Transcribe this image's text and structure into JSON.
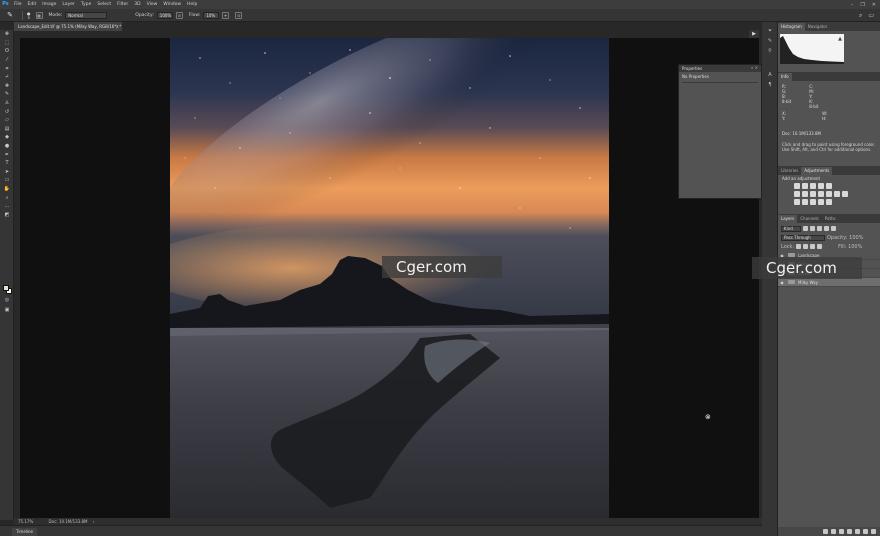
{
  "app": {
    "logo": "Ps"
  },
  "menu": [
    "File",
    "Edit",
    "Image",
    "Layer",
    "Type",
    "Select",
    "Filter",
    "3D",
    "View",
    "Window",
    "Help"
  ],
  "window_controls": [
    "–",
    "❐",
    "✕"
  ],
  "options_bar": {
    "brush_size": "5",
    "mode_label": "Mode:",
    "mode_value": "Normal",
    "opacity_label": "Opacity:",
    "opacity_value": "100%",
    "flow_label": "Flow:",
    "flow_value": "10%"
  },
  "document_tab": {
    "title": "Landscape_Edit.tif @ 75.1% (Milky Way, RGB/16*) *",
    "close": "×"
  },
  "status": {
    "zoom": "75.17%",
    "doc": "Doc: 10.1M/133.8M"
  },
  "timeline": {
    "label": "Timeline"
  },
  "properties": {
    "title": "Properties",
    "message": "No Properties",
    "close": "«  ×"
  },
  "panels": {
    "histogram_tabs": [
      "Histogram",
      "Navigator"
    ],
    "info_tab": "Info",
    "info_left": [
      "R:",
      "G:",
      "B:",
      "8-bit"
    ],
    "info_right": [
      "C:",
      "M:",
      "Y:",
      "K:",
      "8-bit"
    ],
    "info_xy_left": [
      "X:",
      "Y:"
    ],
    "info_xy_right": [
      "W:",
      "H:"
    ],
    "doc_size": "Doc: 10.1M/133.8M",
    "hint": "Click and drag to paint using foreground color. Use Shift, Alt, and Ctrl for additional options.",
    "adj_tabs": [
      "Libraries",
      "Adjustments"
    ],
    "adj_title": "Add an adjustment",
    "layer_tabs": [
      "Layers",
      "Channels",
      "Paths"
    ],
    "kind": "Kind",
    "blend": "Pass Through",
    "opacity": "Opacity: 100%",
    "lock": "Lock:",
    "fill": "Fill: 100%",
    "layers": [
      {
        "name": "Landscape",
        "selected": false
      },
      {
        "name": "Color",
        "selected": false
      },
      {
        "name": "Sunset",
        "selected": false
      },
      {
        "name": "Milky Way",
        "selected": true
      }
    ]
  },
  "watermark": "Cger.com",
  "tools": [
    "move-tool",
    "marquee-tool",
    "lasso-tool",
    "quick-select-tool",
    "crop-tool",
    "eyedropper-tool",
    "healing-tool",
    "brush-tool",
    "clone-stamp-tool",
    "history-brush-tool",
    "eraser-tool",
    "gradient-tool",
    "blur-tool",
    "dodge-tool",
    "pen-tool",
    "type-tool",
    "path-select-tool",
    "shape-tool",
    "hand-tool",
    "zoom-tool",
    "more-tools"
  ]
}
